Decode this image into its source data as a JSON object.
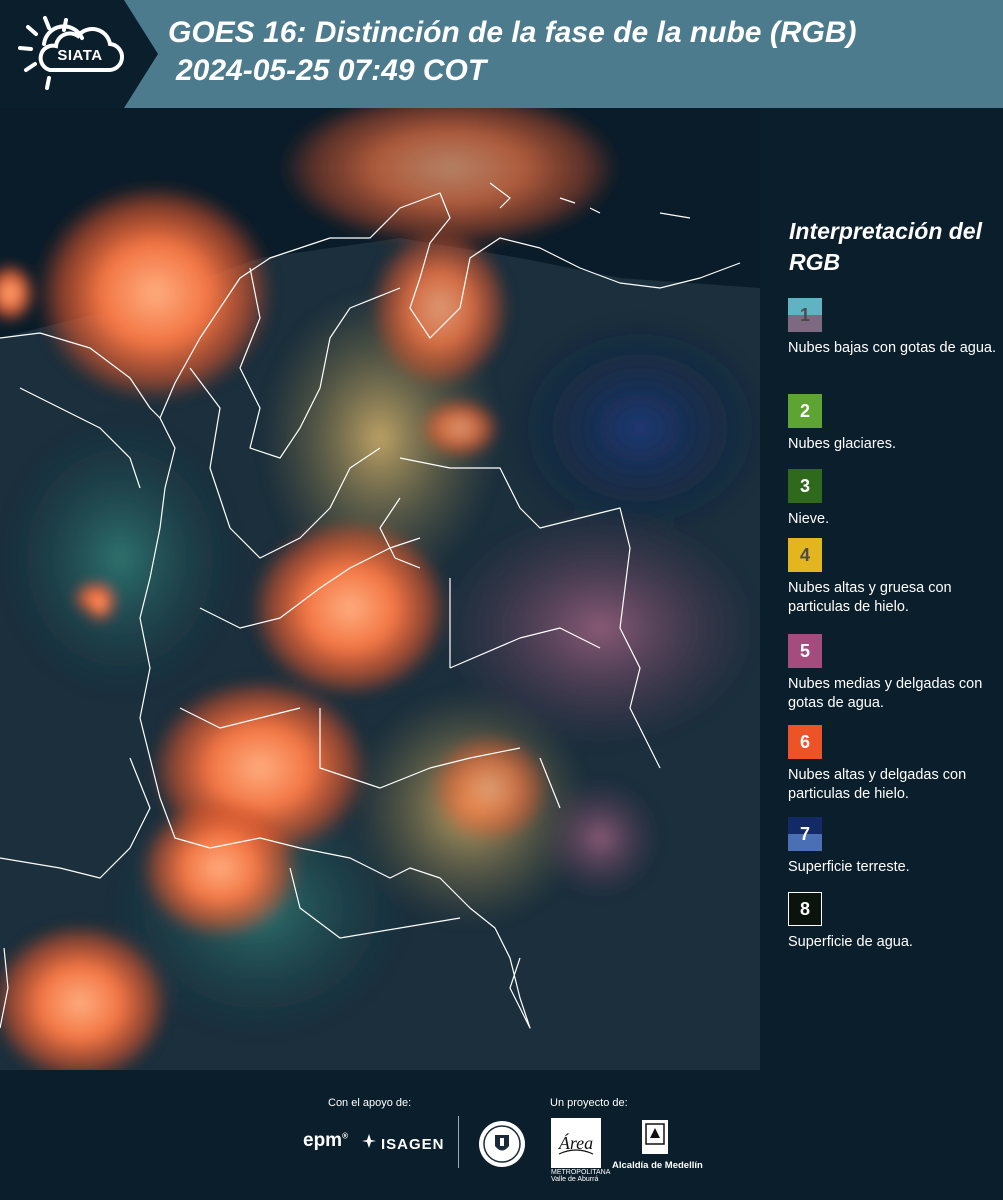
{
  "header": {
    "logo_text": "SIATA",
    "title_line1": "GOES 16: Distinción de la fase de la nube (RGB)",
    "title_line2": "2024-05-25 07:49 COT",
    "background_color": "#4d7b8e",
    "logo_panel_color": "#0b1e2b"
  },
  "legend": {
    "title": "Interpretación del RGB",
    "items": [
      {
        "number": "1",
        "description": "Nubes bajas con gotas de agua.",
        "color_top": "#5fb3c2",
        "color_bottom": "#7d6a82",
        "number_color": "#4a4a4a"
      },
      {
        "number": "2",
        "description": "Nubes glaciares.",
        "color_top": "#5ea432",
        "color_bottom": "#5ea432",
        "number_color": "#ffffff"
      },
      {
        "number": "3",
        "description": "Nieve.",
        "color_top": "#2f6a1c",
        "color_bottom": "#2f6a1c",
        "number_color": "#ffffff"
      },
      {
        "number": "4",
        "description": "Nubes altas y gruesa con particulas de hielo.",
        "color_top": "#e3b51e",
        "color_bottom": "#e3b51e",
        "number_color": "#4a4a4a"
      },
      {
        "number": "5",
        "description": "Nubes medias y delgadas con gotas de agua.",
        "color_top": "#a54c7e",
        "color_bottom": "#a54c7e",
        "number_color": "#ffffff"
      },
      {
        "number": "6",
        "description": "Nubes altas y delgadas con particulas de hielo.",
        "color_top": "#ec5326",
        "color_bottom": "#ec5326",
        "number_color": "#ffffff"
      },
      {
        "number": "7",
        "description": "Superficie terreste.",
        "color_top": "#142a66",
        "color_bottom": "#4b6fb5",
        "number_color": "#ffffff"
      },
      {
        "number": "8",
        "description": "Superficie de agua.",
        "color_top": "#0a140d",
        "color_bottom": "#0a140d",
        "number_color": "#ffffff"
      }
    ]
  },
  "footer": {
    "support_label": "Con el apoyo de:",
    "project_label": "Un proyecto de:",
    "epm_text": "epm",
    "epm_mark": "®",
    "isagen_text": "ISAGEN",
    "area_name": "METROPOLITANA Valle de Aburrá",
    "area_logo_word": "Área",
    "alcaldia_name": "Alcaldía de Medellín"
  },
  "map": {
    "image_kind": "satellite-rgb-composite",
    "cloud_color": "#ff7a45",
    "ocean_color": "#0a1c2a",
    "land_color": "#1e3448",
    "border_color": "#ffffff"
  }
}
